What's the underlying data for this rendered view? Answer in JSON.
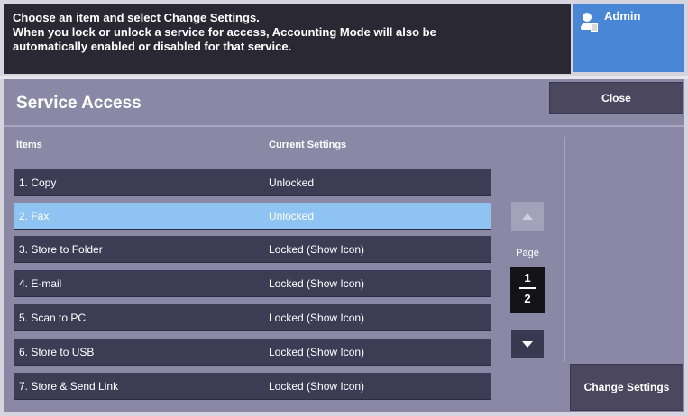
{
  "message": {
    "lines": [
      "Choose an item and select Change Settings.",
      "When you lock or unlock a service for access, Accounting Mode will also be",
      "automatically enabled or disabled for that service."
    ]
  },
  "user": {
    "label": "Admin",
    "icon": "admin-user-icon"
  },
  "header": {
    "title": "Service Access",
    "close_label": "Close"
  },
  "table": {
    "columns": [
      "Items",
      "Current Settings"
    ],
    "rows": [
      {
        "label": "1.   Copy",
        "value": "Unlocked",
        "selected": false
      },
      {
        "label": "2.   Fax",
        "value": "Unlocked",
        "selected": true
      },
      {
        "label": "3.   Store to Folder",
        "value": "Locked (Show Icon)",
        "selected": false
      },
      {
        "label": "4.   E-mail",
        "value": "Locked (Show Icon)",
        "selected": false
      },
      {
        "label": "5.   Scan to PC",
        "value": "Locked (Show Icon)",
        "selected": false
      },
      {
        "label": "6.   Store to USB",
        "value": "Locked (Show Icon)",
        "selected": false
      },
      {
        "label": "7.   Store & Send Link",
        "value": "Locked (Show Icon)",
        "selected": false
      }
    ]
  },
  "pagination": {
    "label": "Page",
    "current": "1",
    "total": "2"
  },
  "actions": {
    "change_settings_label": "Change Settings"
  },
  "colors": {
    "selected_row": "#8fc3f2",
    "admin_button": "#4a86d6",
    "row_bg": "#3e3b55",
    "panel_bg": "#8b88a6"
  }
}
